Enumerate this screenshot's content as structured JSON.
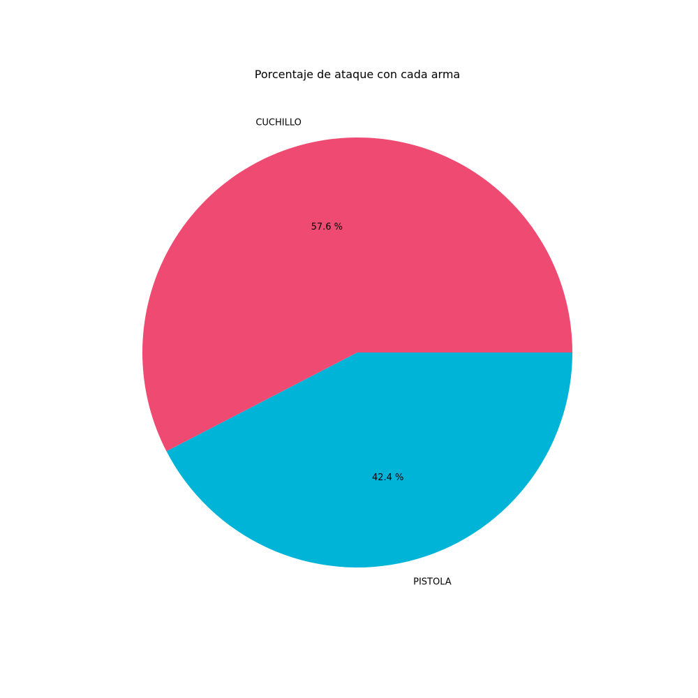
{
  "chart_data": {
    "type": "pie",
    "title": "Porcentaje de ataque con cada arma",
    "slices": [
      {
        "label": "CUCHILLO",
        "value": 57.6,
        "pct_label": "57.6 %",
        "color": "#ef4a72"
      },
      {
        "label": "PISTOLA",
        "value": 42.4,
        "pct_label": "42.4 %",
        "color": "#00b4d8"
      }
    ]
  }
}
